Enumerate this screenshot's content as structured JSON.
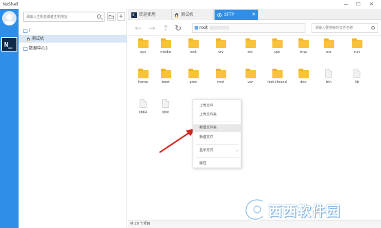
{
  "window": {
    "title": "NxShell",
    "controls": {
      "minimize": "—",
      "maximize": "☐",
      "close": "✕"
    }
  },
  "leftbar": {
    "avatar_icon": "user-avatar-icon",
    "logo_text": "N_"
  },
  "sidebar": {
    "search_placeholder": "请输入主机名或者主机地址",
    "folder_button": "folder-add-icon",
    "add_button": "+",
    "tree": [
      {
        "label": "i",
        "icon": "folder-icon",
        "selected": false
      },
      {
        "label": "测试机",
        "icon": "linux-penguin-icon",
        "selected": true
      },
      {
        "label": "数据中心1",
        "icon": "folder-icon",
        "selected": false
      }
    ]
  },
  "tabs": [
    {
      "label": "欢迎使用",
      "icon": "nxshell-icon",
      "active": false
    },
    {
      "label": "测试机",
      "icon": "linux-penguin-icon",
      "active": false
    },
    {
      "label": "SFTP",
      "icon": "sftp-gear-icon",
      "active": true
    }
  ],
  "navbar": {
    "path": "root",
    "search_placeholder": "请输入要搜索的文件名称"
  },
  "files": [
    {
      "name": "sys",
      "type": "folder"
    },
    {
      "name": "media",
      "type": "folder"
    },
    {
      "name": "root",
      "type": "folder"
    },
    {
      "name": "srv",
      "type": "folder"
    },
    {
      "name": "etc",
      "type": "folder"
    },
    {
      "name": "opt",
      "type": "folder"
    },
    {
      "name": "tmp",
      "type": "folder"
    },
    {
      "name": "usr",
      "type": "folder"
    },
    {
      "name": "run",
      "type": "folder"
    },
    {
      "name": "home",
      "type": "folder"
    },
    {
      "name": "boot",
      "type": "folder"
    },
    {
      "name": "proc",
      "type": "folder"
    },
    {
      "name": "mnt",
      "type": "folder"
    },
    {
      "name": "var",
      "type": "folder"
    },
    {
      "name": "lost+found",
      "type": "folder"
    },
    {
      "name": "dev",
      "type": "folder"
    },
    {
      "name": "bin",
      "type": "file"
    },
    {
      "name": "lib",
      "type": "file"
    },
    {
      "name": "lib64",
      "type": "file"
    },
    {
      "name": "sbin",
      "type": "file"
    }
  ],
  "context_menu": {
    "items": [
      {
        "label": "上传文件"
      },
      {
        "label": "上传文件夹"
      },
      {
        "label": "新建文件夹",
        "hover": true
      },
      {
        "label": "新建文件"
      },
      {
        "label": "显示方式",
        "submenu": "›"
      },
      {
        "label": "属性"
      }
    ]
  },
  "statusbar": {
    "text": "共 20 个项目"
  },
  "watermark": {
    "text": "西西软件园"
  }
}
